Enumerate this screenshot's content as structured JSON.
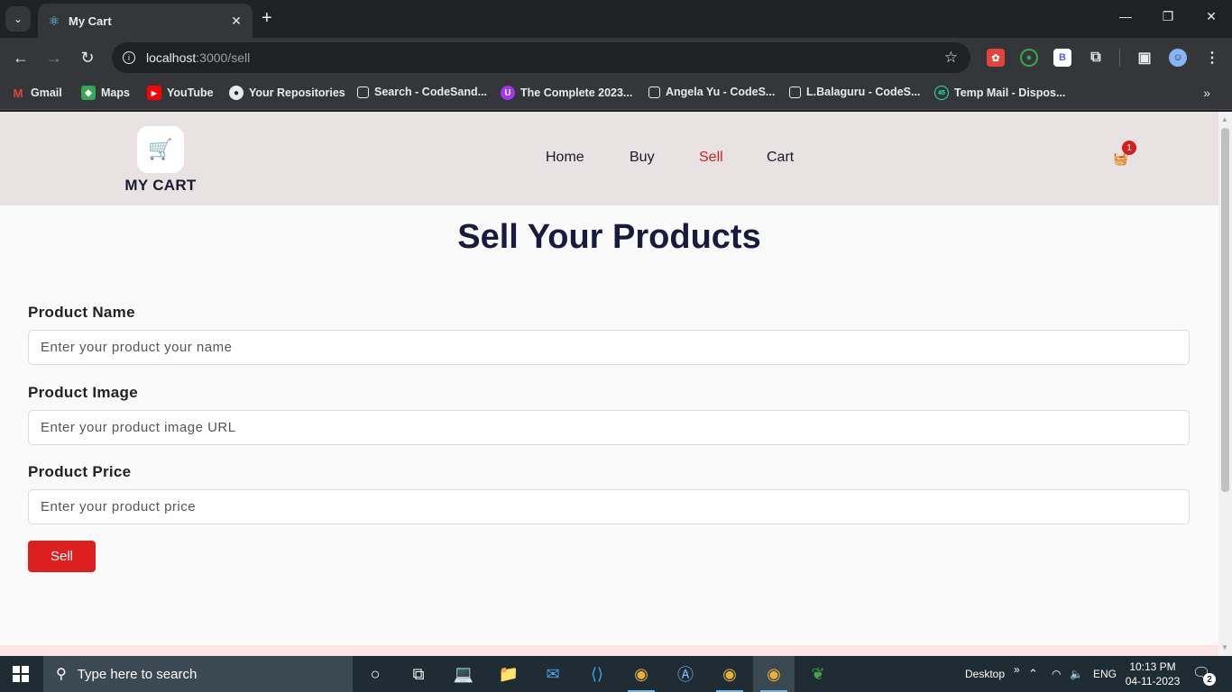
{
  "browser": {
    "tab_title": "My Cart",
    "tab_close": "✕",
    "new_tab": "+",
    "url_host": "localhost",
    "url_path": ":3000/sell",
    "bookmarks": [
      {
        "label": "Gmail",
        "icon": "gmail-icon"
      },
      {
        "label": "Maps",
        "icon": "maps-icon"
      },
      {
        "label": "YouTube",
        "icon": "youtube-icon"
      },
      {
        "label": "Your Repositories",
        "icon": "github-icon"
      },
      {
        "label": "Search - CodeSand...",
        "icon": "codesandbox-icon"
      },
      {
        "label": "The Complete 2023...",
        "icon": "udemy-icon"
      },
      {
        "label": "Angela Yu - CodeS...",
        "icon": "codesandbox-icon"
      },
      {
        "label": "L.Balaguru - CodeS...",
        "icon": "codesandbox-icon"
      },
      {
        "label": "Temp Mail - Dispos...",
        "icon": "tempmail-icon"
      }
    ],
    "more_bookmarks": "»"
  },
  "site": {
    "logo_text": "MY CART",
    "nav": [
      {
        "label": "Home",
        "active": false
      },
      {
        "label": "Buy",
        "active": false
      },
      {
        "label": "Sell",
        "active": true
      },
      {
        "label": "Cart",
        "active": false
      }
    ],
    "cart_count": "1",
    "accent_color": "#dc1f1f"
  },
  "form": {
    "title": "Sell Your Products",
    "fields": [
      {
        "label": "Product Name",
        "placeholder": "Enter your product your name",
        "value": ""
      },
      {
        "label": "Product Image",
        "placeholder": "Enter your product image URL",
        "value": ""
      },
      {
        "label": "Product Price",
        "placeholder": "Enter your product price",
        "value": ""
      }
    ],
    "submit_label": "Sell"
  },
  "taskbar": {
    "search_placeholder": "Type here to search",
    "desktop_label": "Desktop",
    "desktop_chevron": "»",
    "language": "ENG",
    "time": "10:13 PM",
    "date": "04-11-2023",
    "notification_count": "2"
  }
}
